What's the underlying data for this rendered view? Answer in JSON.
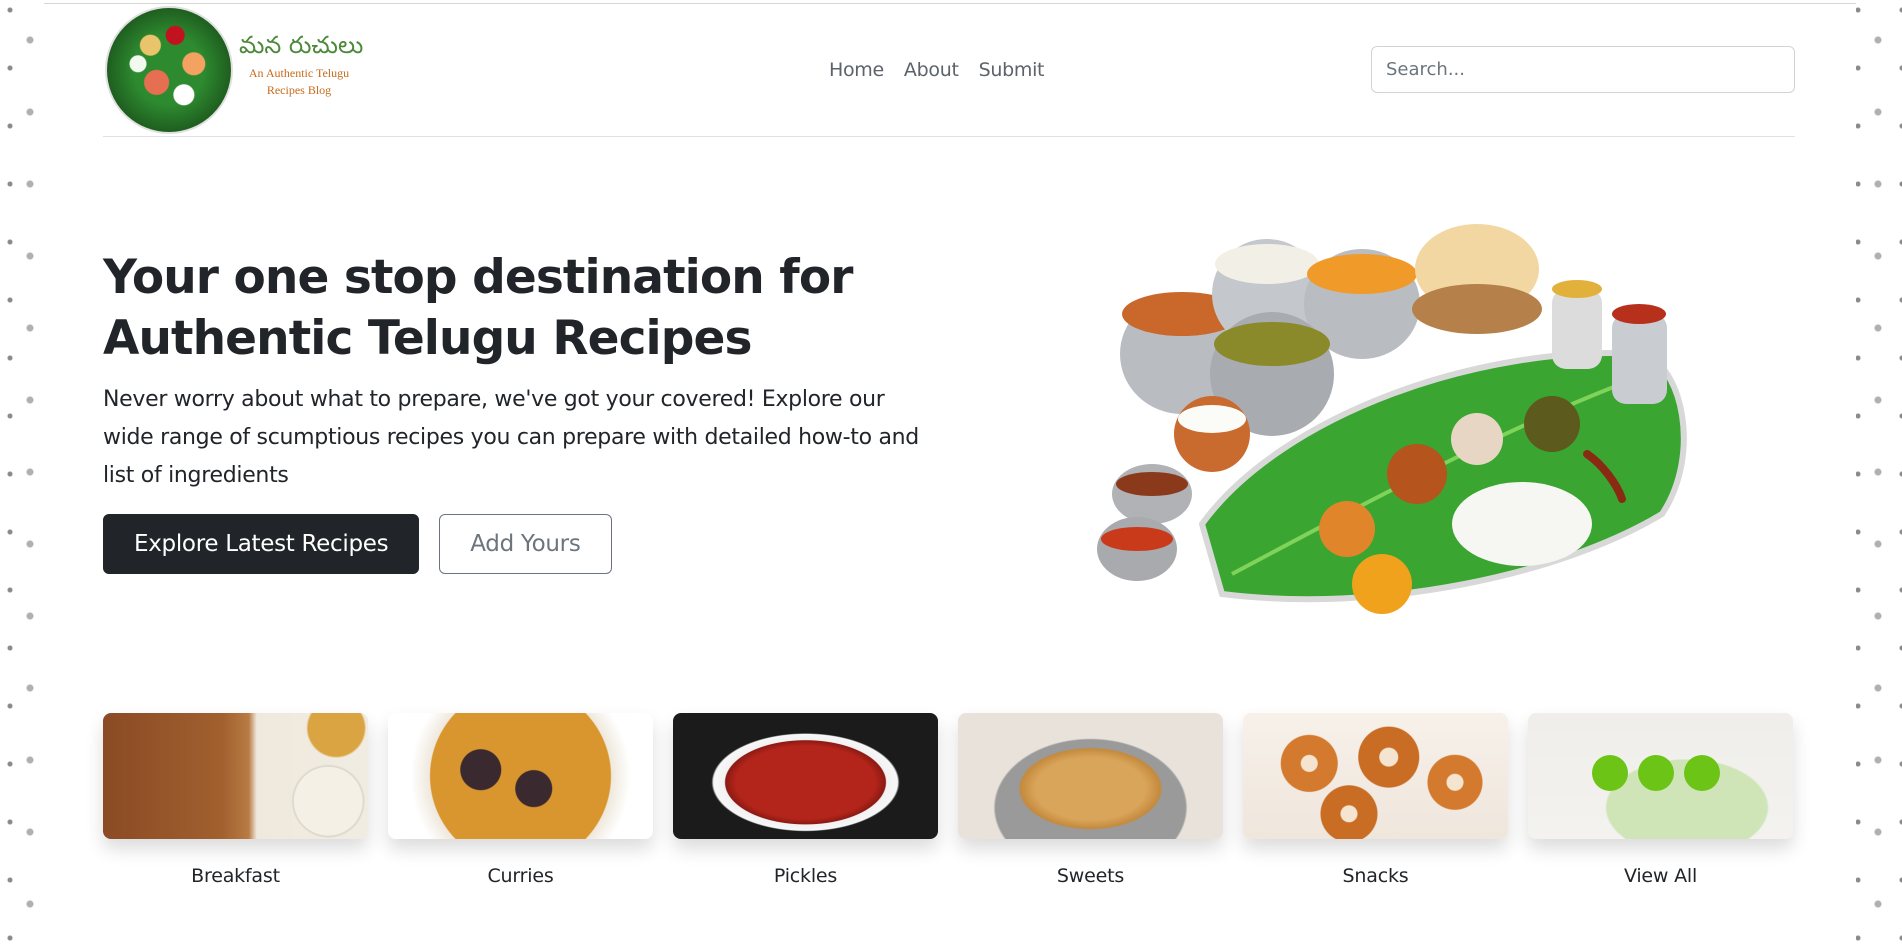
{
  "header": {
    "logo": {
      "title": "మన రుచులు",
      "subtitle": "An Authentic Telugu Recipes Blog"
    },
    "nav": [
      {
        "label": "Home"
      },
      {
        "label": "About"
      },
      {
        "label": "Submit"
      }
    ],
    "search": {
      "placeholder": "Search..."
    }
  },
  "hero": {
    "title": "Your one stop destination for Authentic Telugu Recipes",
    "text": "Never worry about what to prepare, we've got your covered! Explore our wide range of scumptious recipes you can prepare with detailed how-to and list of ingredients",
    "buttons": {
      "primary": "Explore Latest Recipes",
      "secondary": "Add Yours"
    }
  },
  "categories": [
    {
      "label": "Breakfast"
    },
    {
      "label": "Curries"
    },
    {
      "label": "Pickles"
    },
    {
      "label": "Sweets"
    },
    {
      "label": "Snacks"
    },
    {
      "label": "View All"
    }
  ],
  "colors": {
    "accent_dark": "#212529",
    "muted": "#6c757d",
    "dots_green": "#6cc417",
    "leaf_green": "#3aa530"
  }
}
